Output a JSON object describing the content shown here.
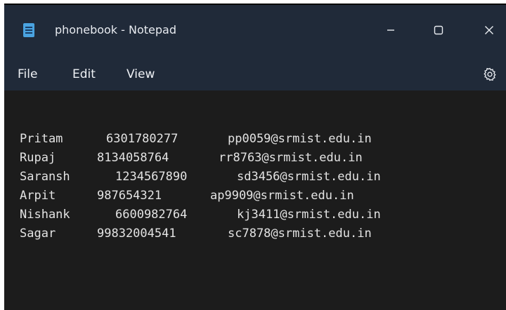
{
  "window": {
    "title": "phonebook - Notepad",
    "minimize_glyph": "—",
    "close_glyph": "✕"
  },
  "menu": {
    "items": [
      "File",
      "Edit",
      "View"
    ],
    "settings_icon": "gear-icon"
  },
  "document": {
    "rows": [
      {
        "name": "Pritam",
        "phone": "6301780277",
        "email": "pp0059@srmist.edu.in"
      },
      {
        "name": "Rupaj",
        "phone": "8134058764",
        "email": "rr8763@srmist.edu.in"
      },
      {
        "name": "Saransh",
        "phone": "1234567890",
        "email": "sd3456@srmist.edu.in"
      },
      {
        "name": "Arpit",
        "phone": "987654321",
        "email": "ap9909@srmist.edu.in"
      },
      {
        "name": "Nishank",
        "phone": "6600982764",
        "email": "kj3411@srmist.edu.in"
      },
      {
        "name": "Sagar",
        "phone": "99832004541",
        "email": "sc7878@srmist.edu.in"
      }
    ]
  },
  "colors": {
    "titlebar": "#202a39",
    "editor_bg": "#1c1c1c",
    "text": "#e3e3e3",
    "app_icon": "#4aa3e0"
  }
}
